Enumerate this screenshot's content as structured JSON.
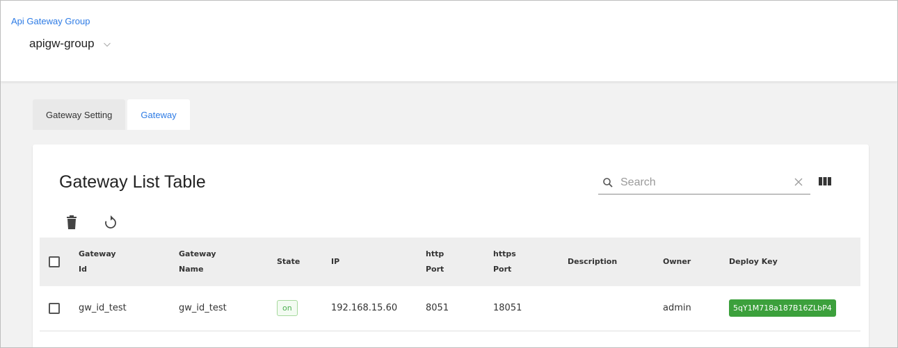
{
  "header": {
    "label": "Api Gateway Group",
    "selected_group": "apigw-group"
  },
  "tabs": [
    {
      "label": "Gateway Setting",
      "active": false
    },
    {
      "label": "Gateway",
      "active": true
    }
  ],
  "card": {
    "title": "Gateway List Table",
    "search": {
      "placeholder": "Search",
      "value": ""
    }
  },
  "table": {
    "headers": {
      "gateway_id": [
        "Gateway",
        "Id"
      ],
      "gateway_name": [
        "Gateway",
        "Name"
      ],
      "state": "State",
      "ip": "IP",
      "http_port": [
        "http",
        "Port"
      ],
      "https_port": [
        "https",
        "Port"
      ],
      "description": "Description",
      "owner": "Owner",
      "deploy_key": "Deploy Key"
    },
    "rows": [
      {
        "gateway_id": "gw_id_test",
        "gateway_name": "gw_id_test",
        "state": "on",
        "ip": "192.168.15.60",
        "http_port": "8051",
        "https_port": "18051",
        "description": "",
        "owner": "admin",
        "deploy_key": "5qY1M718a187B16ZLbP4"
      }
    ]
  },
  "icons": {
    "dropdown": "chevron-down-icon",
    "search": "search-icon",
    "clear": "close-icon",
    "columns": "view-column-icon",
    "delete": "trash-icon",
    "refresh": "refresh-icon"
  },
  "colors": {
    "accent": "#2d7be5",
    "deploy_key_bg": "#3ca03c",
    "state_on": "#4caf50",
    "page_bg": "#f2f2f2"
  }
}
